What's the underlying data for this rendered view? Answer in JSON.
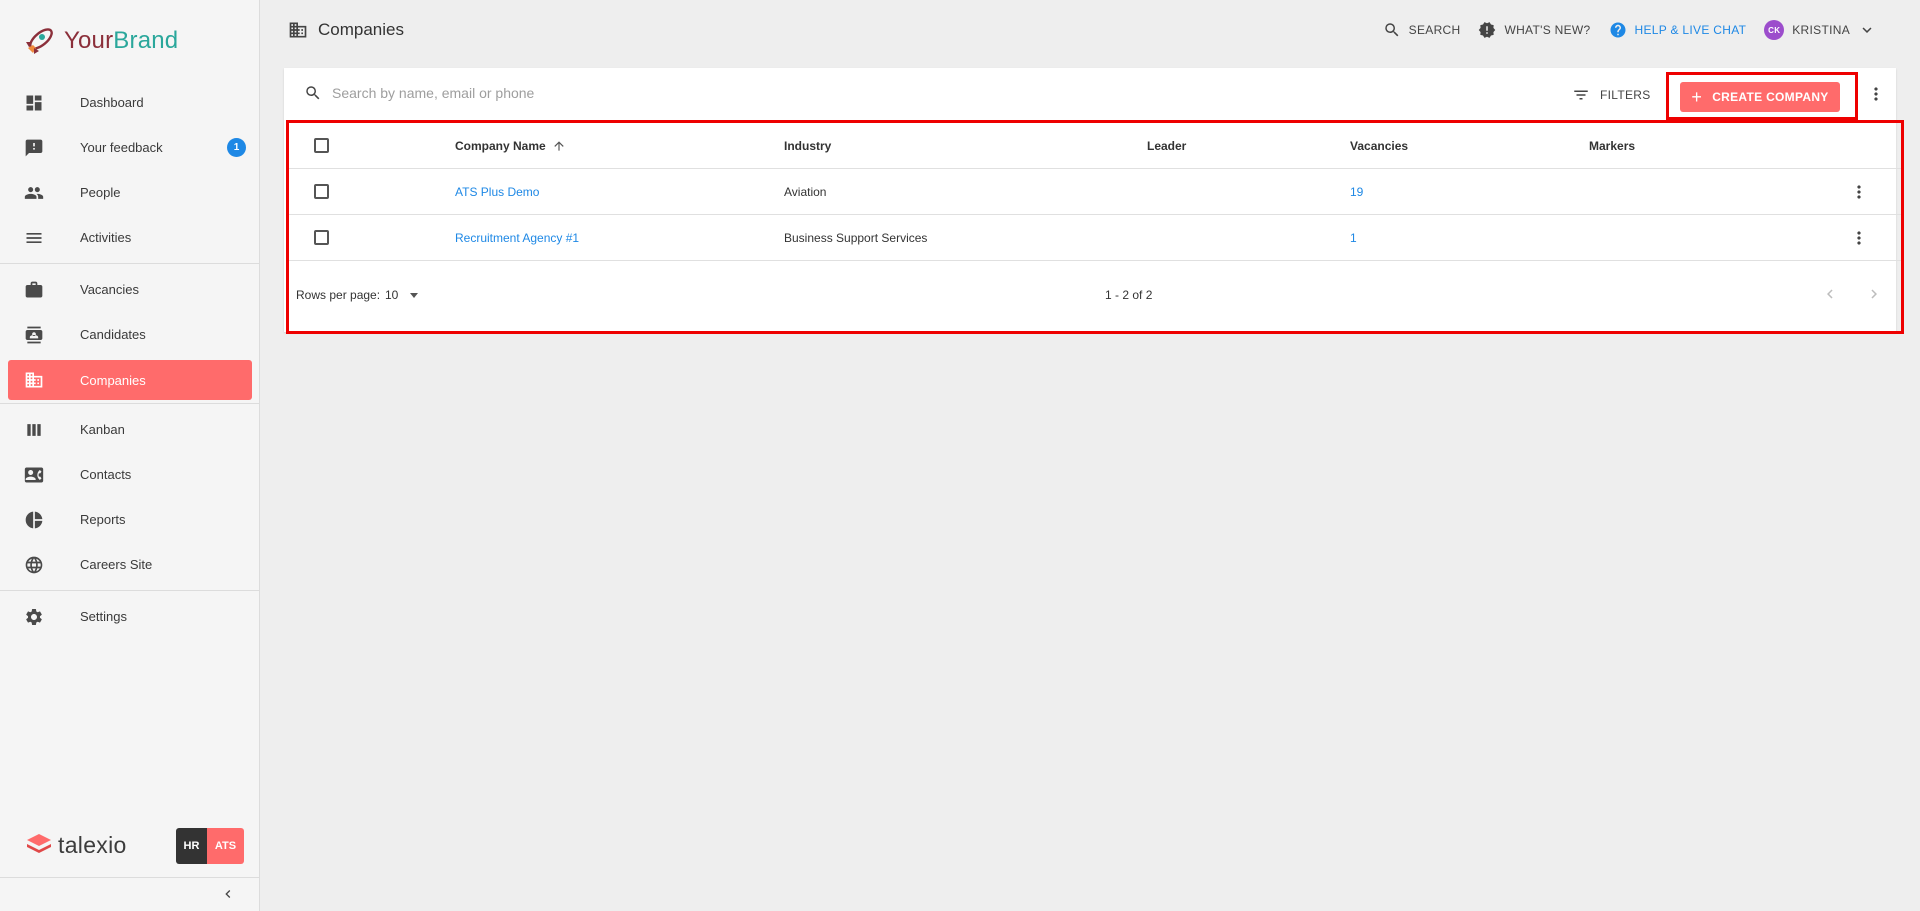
{
  "brand": {
    "name_part1": "Your",
    "name_part2": "Brand"
  },
  "sidebar": {
    "items": [
      {
        "label": "Dashboard",
        "icon": "dashboard-icon"
      },
      {
        "label": "Your feedback",
        "icon": "feedback-icon",
        "badge": "1"
      },
      {
        "label": "People",
        "icon": "people-icon"
      },
      {
        "label": "Activities",
        "icon": "activities-icon"
      },
      {
        "label": "Vacancies",
        "icon": "briefcase-icon"
      },
      {
        "label": "Candidates",
        "icon": "candidate-icon"
      },
      {
        "label": "Companies",
        "icon": "building-icon",
        "active": true
      },
      {
        "label": "Kanban",
        "icon": "kanban-icon"
      },
      {
        "label": "Contacts",
        "icon": "contacts-icon"
      },
      {
        "label": "Reports",
        "icon": "pie-chart-icon"
      },
      {
        "label": "Careers Site",
        "icon": "globe-icon"
      },
      {
        "label": "Settings",
        "icon": "gear-icon"
      }
    ],
    "footer": {
      "product": "talexio",
      "switch_hr": "HR",
      "switch_ats": "ATS"
    }
  },
  "header": {
    "title": "Companies",
    "search_label": "SEARCH",
    "whats_new_label": "WHAT'S NEW?",
    "help_label": "HELP & LIVE CHAT",
    "user_initials": "CK",
    "user_name": "KRISTINA"
  },
  "toolbar": {
    "search_placeholder": "Search by name, email or phone",
    "filters_label": "FILTERS",
    "create_label": "CREATE COMPANY"
  },
  "table": {
    "columns": {
      "name": "Company Name",
      "industry": "Industry",
      "leader": "Leader",
      "vacancies": "Vacancies",
      "markers": "Markers"
    },
    "rows": [
      {
        "name": "ATS Plus Demo",
        "industry": "Aviation",
        "leader": "",
        "vacancies": "19",
        "markers": ""
      },
      {
        "name": "Recruitment Agency #1",
        "industry": "Business Support Services",
        "leader": "",
        "vacancies": "1",
        "markers": ""
      }
    ]
  },
  "pager": {
    "rows_per_page_label": "Rows per page:",
    "rows_per_page_value": "10",
    "range": "1 - 2 of 2"
  },
  "colors": {
    "accent": "#ff6b6b",
    "link": "#1e88e5",
    "highlight": "#ee0000",
    "avatar": "#9c4dcc"
  }
}
